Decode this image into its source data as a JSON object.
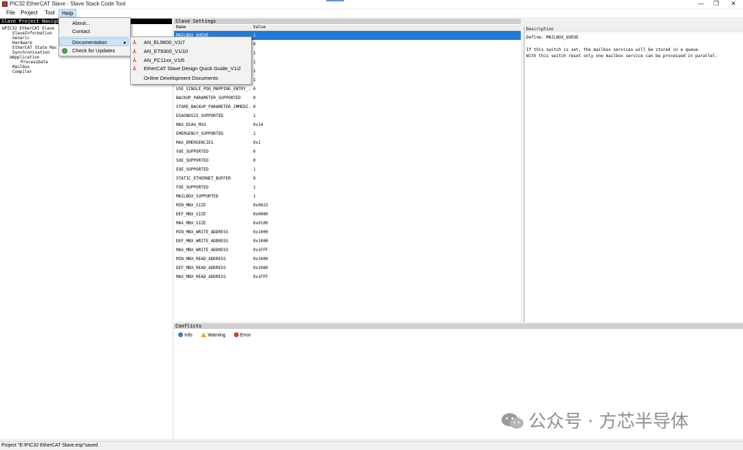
{
  "window": {
    "title": "PIC32 EtherCAT Slave - Slave Stack Code Tool",
    "controls": {
      "minimize": "—",
      "maximize": "❐",
      "close": "✕"
    }
  },
  "menubar": {
    "file": "File",
    "project": "Project",
    "tool": "Tool",
    "help": "Help"
  },
  "help_menu": {
    "items": [
      {
        "label": "About..."
      },
      {
        "label": "Contact"
      },
      {
        "label": "Documentation",
        "arrow": "▸"
      },
      {
        "label": "Check for Updates"
      }
    ]
  },
  "documentation_menu": {
    "items": [
      {
        "label": "AN_EL9800_V1i7",
        "icon": "pdf-icon"
      },
      {
        "label": "AN_ET9300_V1i10",
        "icon": "pdf-icon"
      },
      {
        "label": "AN_FC11xx_V1i5",
        "icon": "pdf-icon"
      },
      {
        "label": "EtherCAT Slave Design Quick Guide_V1i2",
        "icon": "pdf-icon"
      },
      {
        "label": "Online Development Documents"
      }
    ]
  },
  "navigation": {
    "title": "Slave Project Navigation",
    "tree": [
      {
        "label": "PIC32 EtherCAT Slave",
        "level": 0,
        "expander": "⊟"
      },
      {
        "label": "SlaveInformation",
        "level": 1
      },
      {
        "label": "Generic",
        "level": 1
      },
      {
        "label": "Hardware",
        "level": 1
      },
      {
        "label": "EtherCAT State Mac",
        "level": 1
      },
      {
        "label": "Synchronisation",
        "level": 1
      },
      {
        "label": "Application",
        "level": 1,
        "expander": "⊟"
      },
      {
        "label": "ProcessData",
        "level": 2
      },
      {
        "label": "Mailbox",
        "level": 1
      },
      {
        "label": "Compiler",
        "level": 1
      }
    ]
  },
  "settings": {
    "title": "Slave Settings",
    "columns": {
      "name": "Name",
      "value": "Value"
    },
    "rows": [
      {
        "name": "MAILBOX_QUEUE",
        "value": "1",
        "selected": true
      },
      {
        "name": "",
        "value": "0"
      },
      {
        "name": "",
        "value": "1"
      },
      {
        "name": "",
        "value": "1"
      },
      {
        "name": "",
        "value": "1"
      },
      {
        "name": "",
        "value": "1"
      },
      {
        "name": "USE_SINGLE_PDO_MAPPING_ENTRY_...",
        "value": "0"
      },
      {
        "name": "BACKUP_PARAMETER_SUPPORTED",
        "value": "0"
      },
      {
        "name": "STORE_BACKUP_PARAMETER_IMMEDI...",
        "value": "0"
      },
      {
        "name": "DIAGNOSIS_SUPPORTED",
        "value": "1"
      },
      {
        "name": "MAX_DIAG_MSG",
        "value": "0x14"
      },
      {
        "name": "EMERGENCY_SUPPORTED",
        "value": "1"
      },
      {
        "name": "MAX_EMERGENCIES",
        "value": "0x1"
      },
      {
        "name": "VOE_SUPPORTED",
        "value": "0"
      },
      {
        "name": "SOE_SUPPORTED",
        "value": "0"
      },
      {
        "name": "EOE_SUPPORTED",
        "value": "1"
      },
      {
        "name": "STATIC_ETHERNET_BUFFER",
        "value": "0"
      },
      {
        "name": "FOE_SUPPORTED",
        "value": "1"
      },
      {
        "name": "MAILBOX_SUPPORTED",
        "value": "1"
      },
      {
        "name": "MIN_MBX_SIZE",
        "value": "0x0022"
      },
      {
        "name": "DEF_MBX_SIZE",
        "value": "0x0080"
      },
      {
        "name": "MAX_MBX_SIZE",
        "value": "0x0100"
      },
      {
        "name": "MIN_MBX_WRITE_ADDRESS",
        "value": "0x1000"
      },
      {
        "name": "DEF_MBX_WRITE_ADDRESS",
        "value": "0x1000"
      },
      {
        "name": "MAX_MBX_WRITE_ADDRESS",
        "value": "0x1FFF"
      },
      {
        "name": "MIN_MBX_READ_ADDRESS",
        "value": "0x1000"
      },
      {
        "name": "DEF_MBX_READ_ADDRESS",
        "value": "0x1080"
      },
      {
        "name": "MAX_MBX_READ_ADDRESS",
        "value": "0x1FFF"
      }
    ]
  },
  "description": {
    "title": "Description",
    "define_line": "Define: MAILBOX_QUEUE",
    "text_line1": "If this switch is set, the mailbox services will be stored in a queue.",
    "text_line2": "With this switch reset only one mailbox service can be processed in parallel."
  },
  "conflicts": {
    "title": "Conflicts",
    "tabs": [
      {
        "label": "Info",
        "icon": "info-icon",
        "color": "#2f7fc9"
      },
      {
        "label": "Warning",
        "icon": "warning-icon",
        "color": "#e8b400"
      },
      {
        "label": "Error",
        "icon": "error-icon",
        "color": "#d23a2e"
      }
    ]
  },
  "status": {
    "text": "Project \"E:\\PIC32 EtherCAT Slave.esp\"saved"
  },
  "watermark": {
    "text": "公众号 · 方芯半导体"
  }
}
